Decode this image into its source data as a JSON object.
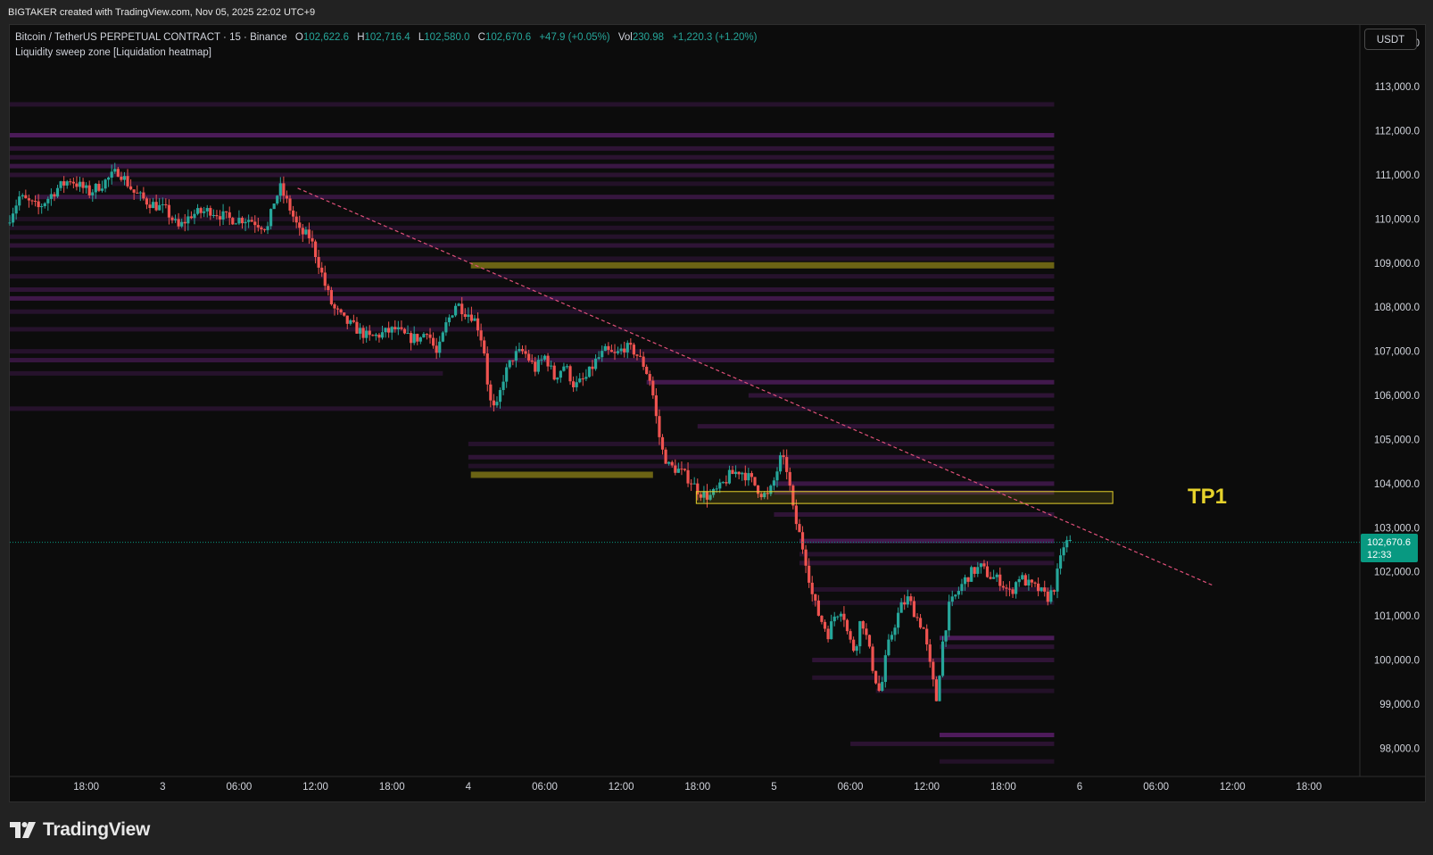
{
  "header": {
    "credit": "BIGTAKER created with TradingView.com, Nov 05, 2025 22:02 UTC+9"
  },
  "legend": {
    "symbol": "Bitcoin / TetherUS PERPETUAL CONTRACT · 15 · Binance",
    "open_label": "O",
    "open": "102,622.6",
    "high_label": "H",
    "high": "102,716.4",
    "low_label": "L",
    "low": "102,580.0",
    "close_label": "C",
    "close": "102,670.6",
    "change": "+47.9 (+0.05%)",
    "vol_label": "Vol",
    "vol": "230.98",
    "vol_change": "+1,220.3 (+1.20%)",
    "indicator": "Liquidity sweep zone [Liquidation heatmap]"
  },
  "currency": "USDT",
  "last_price": {
    "price": "102,670.6",
    "countdown": "12:33"
  },
  "annotation": {
    "label": "TP1"
  },
  "footer": {
    "brand": "TradingView"
  },
  "colors": {
    "up": "#26a69a",
    "down": "#ef5350",
    "heat": "#5a1f6a",
    "zone": "#6b6314",
    "tp1": "#e6d22b",
    "trendline": "#e0507a",
    "last_price_line": "#089981"
  },
  "chart_data": {
    "type": "candlestick",
    "ylim": [
      97400,
      114400
    ],
    "y_ticks": [
      98000,
      99000,
      100000,
      101000,
      102000,
      103000,
      104000,
      105000,
      106000,
      107000,
      108000,
      109000,
      110000,
      111000,
      112000,
      113000,
      114000
    ],
    "y_tick_labels": [
      "98,000.0",
      "99,000.0",
      "100,000.0",
      "101,000.0",
      "102,000.0",
      "103,000.0",
      "104,000.0",
      "105,000.0",
      "106,000.0",
      "107,000.0",
      "108,000.0",
      "109,000.0",
      "110,000.0",
      "111,000.0",
      "112,000.0",
      "113,000.0",
      "114,000.0"
    ],
    "x_ticks": [
      {
        "t": 18,
        "label": "18:00"
      },
      {
        "t": 24,
        "label": "3"
      },
      {
        "t": 30,
        "label": "06:00"
      },
      {
        "t": 36,
        "label": "12:00"
      },
      {
        "t": 42,
        "label": "18:00"
      },
      {
        "t": 48,
        "label": "4"
      },
      {
        "t": 54,
        "label": "06:00"
      },
      {
        "t": 60,
        "label": "12:00"
      },
      {
        "t": 66,
        "label": "18:00"
      },
      {
        "t": 72,
        "label": "5"
      },
      {
        "t": 78,
        "label": "06:00"
      },
      {
        "t": 84,
        "label": "12:00"
      },
      {
        "t": 90,
        "label": "18:00"
      },
      {
        "t": 96,
        "label": "6"
      },
      {
        "t": 102,
        "label": "06:00"
      },
      {
        "t": 108,
        "label": "12:00"
      },
      {
        "t": 114,
        "label": "18:00"
      }
    ],
    "x_unit": "hours since Nov 2 00:00",
    "xlim": [
      12,
      118
    ],
    "price_path": [
      [
        12.0,
        109900
      ],
      [
        13.0,
        110500
      ],
      [
        14.5,
        110250
      ],
      [
        16.0,
        110700
      ],
      [
        17.0,
        110900
      ],
      [
        18.5,
        110600
      ],
      [
        19.5,
        110800
      ],
      [
        20.8,
        111100
      ],
      [
        22.0,
        110600
      ],
      [
        23.0,
        110400
      ],
      [
        24.5,
        110200
      ],
      [
        25.5,
        109800
      ],
      [
        26.5,
        110100
      ],
      [
        28.0,
        110200
      ],
      [
        29.5,
        110000
      ],
      [
        31.0,
        110000
      ],
      [
        32.5,
        109800
      ],
      [
        33.0,
        110400
      ],
      [
        33.5,
        110700
      ],
      [
        34.3,
        110200
      ],
      [
        35.0,
        109700
      ],
      [
        35.8,
        109600
      ],
      [
        36.5,
        109000
      ],
      [
        37.0,
        108500
      ],
      [
        37.6,
        108000
      ],
      [
        38.5,
        107700
      ],
      [
        39.5,
        107500
      ],
      [
        40.5,
        107300
      ],
      [
        41.5,
        107400
      ],
      [
        42.5,
        107500
      ],
      [
        43.5,
        107300
      ],
      [
        44.5,
        107300
      ],
      [
        45.0,
        107500
      ],
      [
        45.8,
        106900
      ],
      [
        46.5,
        107600
      ],
      [
        47.3,
        108100
      ],
      [
        48.0,
        107900
      ],
      [
        48.6,
        107800
      ],
      [
        49.1,
        107500
      ],
      [
        49.5,
        107000
      ],
      [
        49.9,
        105900
      ],
      [
        50.4,
        105600
      ],
      [
        51.0,
        106400
      ],
      [
        51.8,
        106900
      ],
      [
        52.6,
        107000
      ],
      [
        53.5,
        106600
      ],
      [
        54.3,
        106900
      ],
      [
        55.0,
        106400
      ],
      [
        55.8,
        106700
      ],
      [
        56.6,
        106200
      ],
      [
        57.5,
        106400
      ],
      [
        58.3,
        106800
      ],
      [
        59.0,
        107000
      ],
      [
        59.8,
        106900
      ],
      [
        60.5,
        107100
      ],
      [
        61.3,
        107000
      ],
      [
        62.0,
        106700
      ],
      [
        62.6,
        106300
      ],
      [
        63.0,
        105500
      ],
      [
        63.4,
        104800
      ],
      [
        64.0,
        104400
      ],
      [
        64.8,
        104300
      ],
      [
        65.6,
        104100
      ],
      [
        66.4,
        103800
      ],
      [
        67.2,
        103700
      ],
      [
        68.0,
        103900
      ],
      [
        68.8,
        104200
      ],
      [
        69.6,
        104300
      ],
      [
        70.4,
        104100
      ],
      [
        71.2,
        103800
      ],
      [
        71.8,
        103700
      ],
      [
        72.3,
        104100
      ],
      [
        72.8,
        104600
      ],
      [
        73.3,
        104300
      ],
      [
        73.8,
        103300
      ],
      [
        74.3,
        102800
      ],
      [
        74.8,
        102200
      ],
      [
        75.3,
        101400
      ],
      [
        75.8,
        101000
      ],
      [
        76.5,
        100600
      ],
      [
        77.0,
        101000
      ],
      [
        77.6,
        101200
      ],
      [
        78.1,
        100500
      ],
      [
        78.6,
        100200
      ],
      [
        79.1,
        101000
      ],
      [
        79.6,
        100400
      ],
      [
        80.1,
        99700
      ],
      [
        80.6,
        99200
      ],
      [
        81.1,
        100200
      ],
      [
        81.6,
        100700
      ],
      [
        82.2,
        101200
      ],
      [
        82.8,
        101400
      ],
      [
        83.4,
        101000
      ],
      [
        84.0,
        100700
      ],
      [
        84.6,
        99700
      ],
      [
        85.0,
        99100
      ],
      [
        85.5,
        100400
      ],
      [
        86.0,
        101200
      ],
      [
        86.6,
        101500
      ],
      [
        87.2,
        101800
      ],
      [
        87.8,
        102000
      ],
      [
        88.5,
        102100
      ],
      [
        89.2,
        101900
      ],
      [
        90.0,
        101800
      ],
      [
        90.8,
        101500
      ],
      [
        91.5,
        101900
      ],
      [
        92.3,
        101700
      ],
      [
        93.0,
        101600
      ],
      [
        93.7,
        101400
      ],
      [
        94.2,
        101600
      ],
      [
        94.7,
        102200
      ],
      [
        95.0,
        102600
      ],
      [
        95.3,
        102670
      ]
    ],
    "heatmap_bands": [
      {
        "price": 112600,
        "x0": 12,
        "x1": 94,
        "a": 0.35
      },
      {
        "price": 111900,
        "x0": 12,
        "x1": 94,
        "a": 0.8
      },
      {
        "price": 111600,
        "x0": 12,
        "x1": 94,
        "a": 0.45
      },
      {
        "price": 111400,
        "x0": 12,
        "x1": 94,
        "a": 0.4
      },
      {
        "price": 111200,
        "x0": 12,
        "x1": 94,
        "a": 0.6
      },
      {
        "price": 111000,
        "x0": 12,
        "x1": 94,
        "a": 0.4
      },
      {
        "price": 110800,
        "x0": 20,
        "x1": 94,
        "a": 0.3
      },
      {
        "price": 110500,
        "x0": 14,
        "x1": 94,
        "a": 0.55
      },
      {
        "price": 110000,
        "x0": 12,
        "x1": 94,
        "a": 0.25
      },
      {
        "price": 109800,
        "x0": 12,
        "x1": 94,
        "a": 0.3
      },
      {
        "price": 109600,
        "x0": 12,
        "x1": 94,
        "a": 0.35
      },
      {
        "price": 109400,
        "x0": 12,
        "x1": 94,
        "a": 0.45
      },
      {
        "price": 109100,
        "x0": 12,
        "x1": 94,
        "a": 0.3
      },
      {
        "price": 108700,
        "x0": 12,
        "x1": 94,
        "a": 0.35
      },
      {
        "price": 108400,
        "x0": 12,
        "x1": 94,
        "a": 0.45
      },
      {
        "price": 108200,
        "x0": 12,
        "x1": 94,
        "a": 0.65
      },
      {
        "price": 107900,
        "x0": 12,
        "x1": 94,
        "a": 0.35
      },
      {
        "price": 107500,
        "x0": 12,
        "x1": 94,
        "a": 0.35
      },
      {
        "price": 107000,
        "x0": 12,
        "x1": 94,
        "a": 0.35
      },
      {
        "price": 106800,
        "x0": 12,
        "x1": 94,
        "a": 0.55
      },
      {
        "price": 106500,
        "x0": 12,
        "x1": 46,
        "a": 0.35
      },
      {
        "price": 106300,
        "x0": 62,
        "x1": 94,
        "a": 0.7
      },
      {
        "price": 106000,
        "x0": 70,
        "x1": 94,
        "a": 0.45
      },
      {
        "price": 105700,
        "x0": 12,
        "x1": 94,
        "a": 0.35
      },
      {
        "price": 105300,
        "x0": 66,
        "x1": 94,
        "a": 0.45
      },
      {
        "price": 104900,
        "x0": 48,
        "x1": 94,
        "a": 0.35
      },
      {
        "price": 104600,
        "x0": 48,
        "x1": 94,
        "a": 0.45
      },
      {
        "price": 104400,
        "x0": 48,
        "x1": 94,
        "a": 0.3
      },
      {
        "price": 104000,
        "x0": 72,
        "x1": 94,
        "a": 0.6
      },
      {
        "price": 103800,
        "x0": 72,
        "x1": 94,
        "a": 0.5
      },
      {
        "price": 103300,
        "x0": 72,
        "x1": 94,
        "a": 0.45
      },
      {
        "price": 102700,
        "x0": 74,
        "x1": 94,
        "a": 0.7
      },
      {
        "price": 102400,
        "x0": 74,
        "x1": 94,
        "a": 0.35
      },
      {
        "price": 102200,
        "x0": 74,
        "x1": 94,
        "a": 0.4
      },
      {
        "price": 101600,
        "x0": 75,
        "x1": 94,
        "a": 0.35
      },
      {
        "price": 101300,
        "x0": 75,
        "x1": 94,
        "a": 0.3
      },
      {
        "price": 100500,
        "x0": 85,
        "x1": 94,
        "a": 0.8
      },
      {
        "price": 100300,
        "x0": 85,
        "x1": 94,
        "a": 0.4
      },
      {
        "price": 100000,
        "x0": 75,
        "x1": 94,
        "a": 0.45
      },
      {
        "price": 99600,
        "x0": 75,
        "x1": 94,
        "a": 0.35
      },
      {
        "price": 99300,
        "x0": 80,
        "x1": 94,
        "a": 0.3
      },
      {
        "price": 98300,
        "x0": 85,
        "x1": 94,
        "a": 0.85
      },
      {
        "price": 98100,
        "x0": 78,
        "x1": 94,
        "a": 0.4
      },
      {
        "price": 97700,
        "x0": 85,
        "x1": 94,
        "a": 0.3
      }
    ],
    "sweep_zones": [
      {
        "price": 108950,
        "x0": 48.2,
        "x1": 94
      },
      {
        "price": 104200,
        "x0": 48.2,
        "x1": 62.5
      }
    ],
    "tp1_zone": {
      "x0": 65.9,
      "x1": 98.6,
      "low": 103550,
      "high": 103820
    },
    "trendline": {
      "x0": 34.6,
      "y0": 110700,
      "x1": 106.4,
      "y1": 101700
    },
    "last_price": 102670.6
  }
}
